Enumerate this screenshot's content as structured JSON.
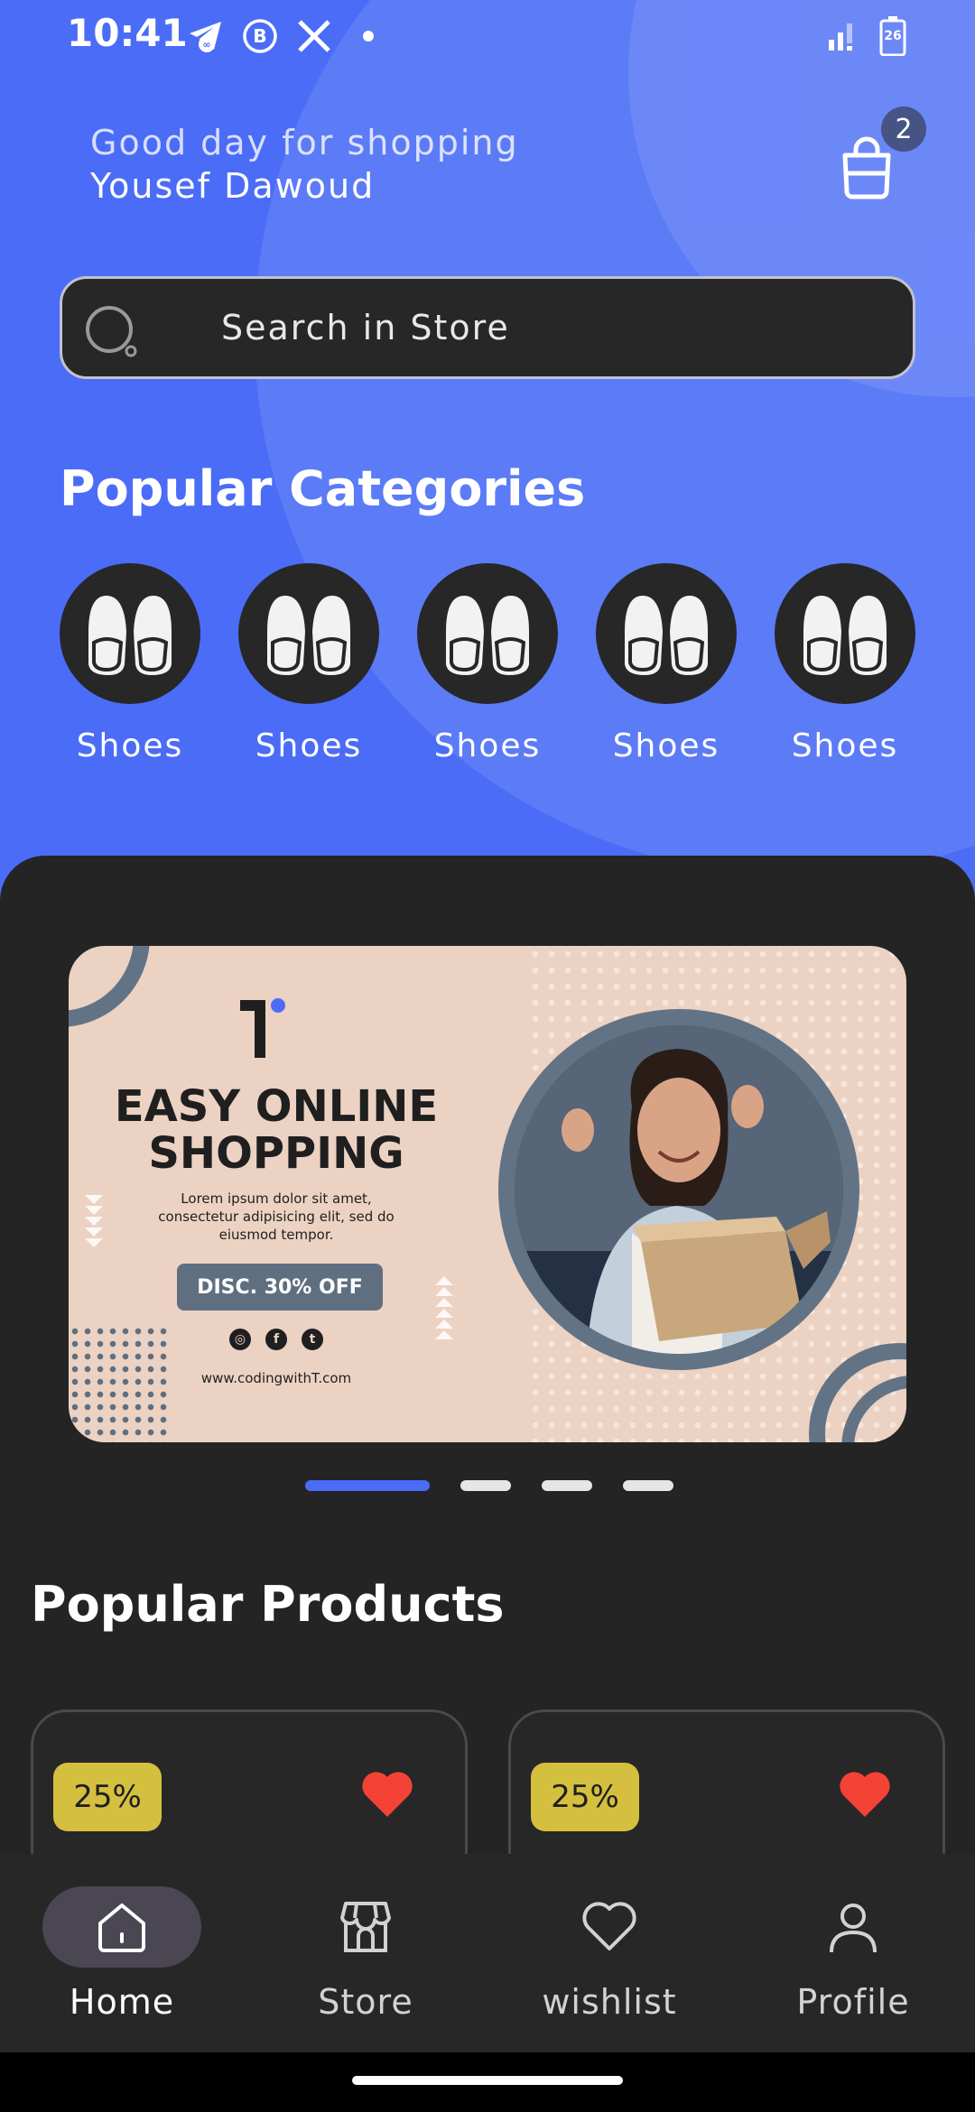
{
  "status_bar": {
    "time": "10:41",
    "left_icons": [
      "telegram-icon",
      "business-whatsapp-icon",
      "x-icon",
      "dot-icon"
    ],
    "right_icons": [
      "signal-icon",
      "battery-icon"
    ],
    "battery_level": "26"
  },
  "header": {
    "greeting": "Good day for shopping",
    "user_name": "Yousef Dawoud",
    "cart_count": "2"
  },
  "search": {
    "placeholder": "Search in Store"
  },
  "categories": {
    "title": "Popular Categories",
    "items": [
      {
        "label": "Shoes",
        "icon": "shoes-icon"
      },
      {
        "label": "Shoes",
        "icon": "shoes-icon"
      },
      {
        "label": "Shoes",
        "icon": "shoes-icon"
      },
      {
        "label": "Shoes",
        "icon": "shoes-icon"
      },
      {
        "label": "Shoes",
        "icon": "shoes-icon"
      }
    ]
  },
  "banner": {
    "title_line1": "EASY ONLINE",
    "title_line2": "SHOPPING",
    "body": "Lorem ipsum dolor sit amet, consectetur adipisicing elit, sed do eiusmod tempor.",
    "button": "DISC. 30% OFF",
    "url": "www.codingwithT.com",
    "slides": 4,
    "active_slide": 1
  },
  "products": {
    "title": "Popular Products",
    "items": [
      {
        "discount": "25%",
        "favorite": true
      },
      {
        "discount": "25%",
        "favorite": true
      }
    ]
  },
  "nav": {
    "items": [
      {
        "label": "Home",
        "icon": "home-icon",
        "active": true
      },
      {
        "label": "Store",
        "icon": "store-icon",
        "active": false
      },
      {
        "label": "wishlist",
        "icon": "heart-icon",
        "active": false
      },
      {
        "label": "Profile",
        "icon": "profile-icon",
        "active": false
      }
    ]
  },
  "colors": {
    "primary": "#4a6cf7",
    "dark": "#242424",
    "discount": "#d5bf3f",
    "favorite": "#f44336"
  }
}
